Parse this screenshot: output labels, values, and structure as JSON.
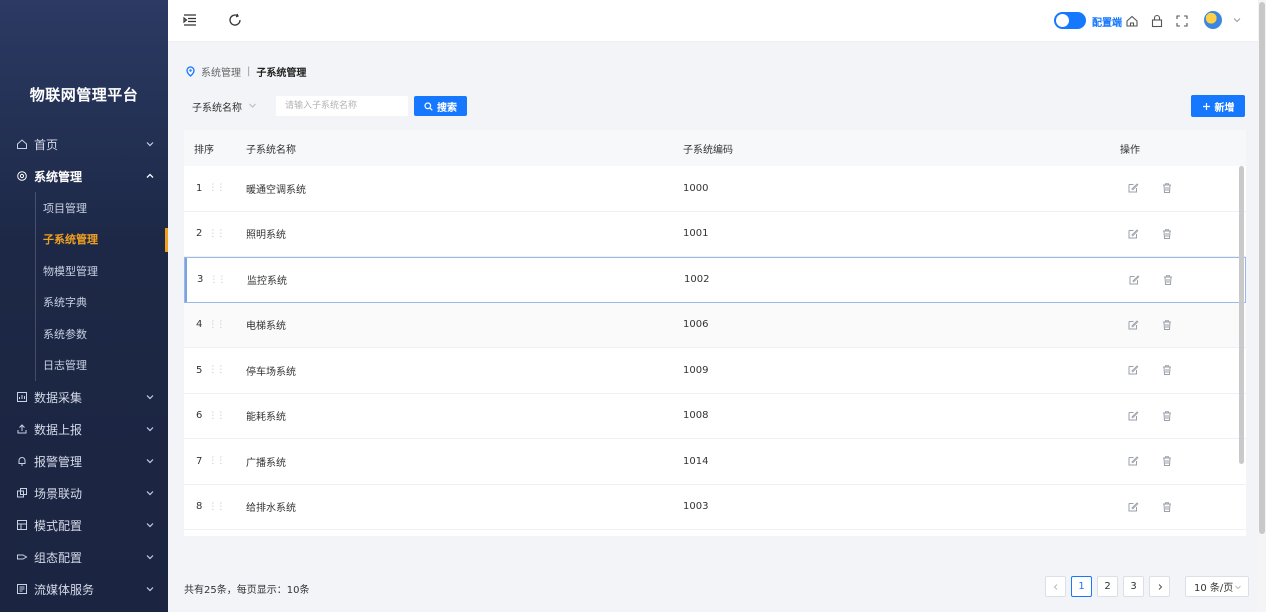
{
  "app": {
    "title": "物联网管理平台"
  },
  "sidebar": {
    "items": [
      {
        "label": "首页",
        "icon": "home-icon"
      },
      {
        "label": "系统管理",
        "icon": "settings-icon",
        "expanded": true
      },
      {
        "label": "数据采集",
        "icon": "data-collect-icon"
      },
      {
        "label": "数据上报",
        "icon": "upload-icon"
      },
      {
        "label": "报警管理",
        "icon": "bell-icon"
      },
      {
        "label": "场景联动",
        "icon": "scene-icon"
      },
      {
        "label": "模式配置",
        "icon": "mode-icon"
      },
      {
        "label": "组态配置",
        "icon": "config-icon"
      },
      {
        "label": "流媒体服务",
        "icon": "media-icon"
      }
    ],
    "sub_items": [
      {
        "label": "项目管理"
      },
      {
        "label": "子系统管理",
        "active": true
      },
      {
        "label": "物模型管理"
      },
      {
        "label": "系统字典"
      },
      {
        "label": "系统参数"
      },
      {
        "label": "日志管理"
      }
    ],
    "active_color": "#f0a020"
  },
  "header": {
    "toggle_label": "配置端",
    "accent": "#1677ff"
  },
  "breadcrumb": {
    "parent": "系统管理",
    "separator": "|",
    "current": "子系统管理"
  },
  "filter": {
    "label": "子系统名称",
    "placeholder": "请输入子系统名称",
    "search_label": "搜索",
    "add_label": "新增"
  },
  "table": {
    "headers": {
      "index": "排序",
      "name": "子系统名称",
      "code": "子系统编码",
      "ops": "操作"
    },
    "rows": [
      {
        "index": "1",
        "name": "暖通空调系统",
        "code": "1000"
      },
      {
        "index": "2",
        "name": "照明系统",
        "code": "1001"
      },
      {
        "index": "3",
        "name": "监控系统",
        "code": "1002"
      },
      {
        "index": "4",
        "name": "电梯系统",
        "code": "1006"
      },
      {
        "index": "5",
        "name": "停车场系统",
        "code": "1009"
      },
      {
        "index": "6",
        "name": "能耗系统",
        "code": "1008"
      },
      {
        "index": "7",
        "name": "广播系统",
        "code": "1014"
      },
      {
        "index": "8",
        "name": "给排水系统",
        "code": "1003"
      }
    ]
  },
  "pagination": {
    "total_text": "共有25条，每页显示：10条",
    "pages": [
      "1",
      "2",
      "3"
    ],
    "current_page": "1",
    "page_size": "10 条/页"
  }
}
